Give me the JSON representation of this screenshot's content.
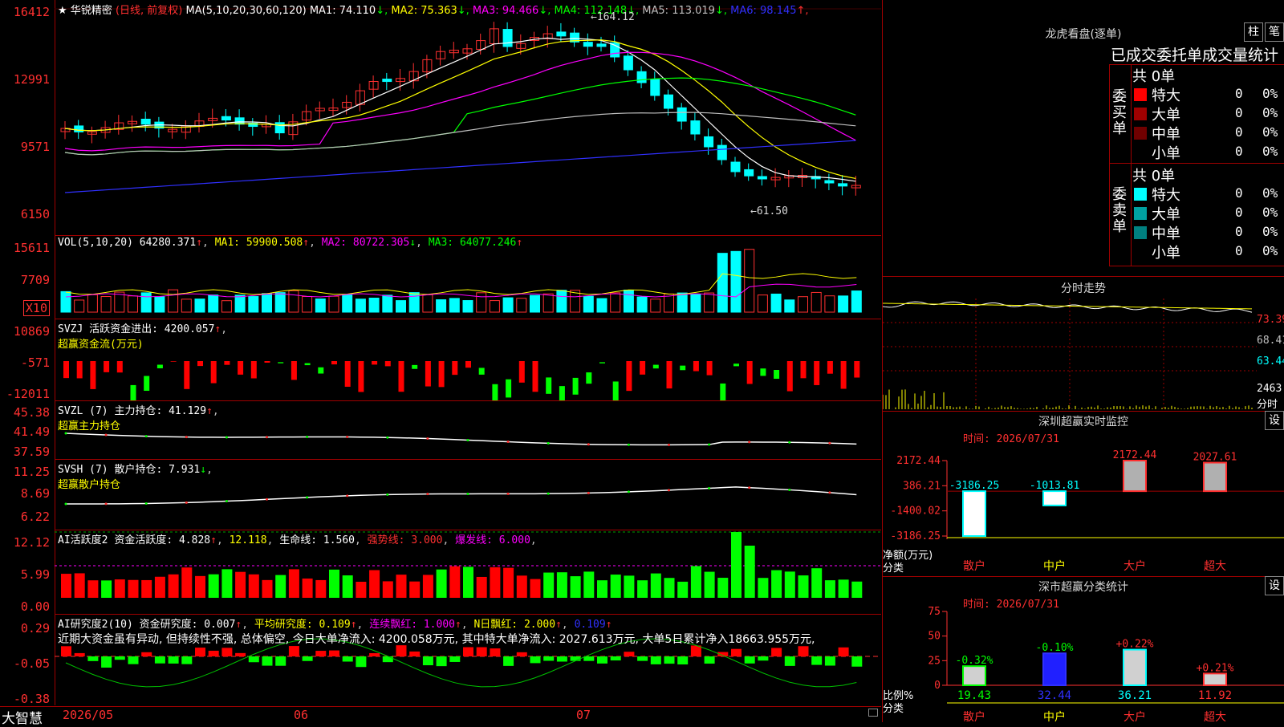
{
  "stock": {
    "name": "华锐精密",
    "mode": "(日线, 前复权)"
  },
  "price_pane": {
    "ma_header": "MA(5,10,20,30,60,120)",
    "ma": [
      {
        "label": "MA1: 74.110",
        "arrow": "↓",
        "color": "#ffffff"
      },
      {
        "label": "MA2: 75.363",
        "arrow": "↓",
        "color": "#ffff00"
      },
      {
        "label": "MA3: 94.466",
        "arrow": "↓",
        "color": "#ff00ff"
      },
      {
        "label": "MA4: 112.148",
        "arrow": "↓",
        "color": "#00ff00"
      },
      {
        "label": "MA5: 113.019",
        "arrow": "↓",
        "color": "#c0c0c0"
      },
      {
        "label": "MA6: 98.145",
        "arrow": "↑",
        "color": "#3030ff"
      }
    ],
    "y_labels": [
      "16412",
      "12991",
      "9571",
      "6150"
    ],
    "high_note": "164.12",
    "low_note": "61.50"
  },
  "vol_pane": {
    "name": "VOL(5,10,20)",
    "value": "64280.371",
    "ma1": "MA1: 59900.508",
    "ma2": "MA2: 80722.305",
    "ma3": "MA3: 64077.246",
    "y_labels": [
      "15611",
      "7709"
    ],
    "unit": "X10"
  },
  "svzj_pane": {
    "name": "SVZJ",
    "title": "活跃资金进出: 4200.057",
    "sub": "超赢资金流(万元)",
    "y_labels": [
      "10869",
      "-571",
      "-12011"
    ]
  },
  "svzl_pane": {
    "name": "SVZL (7)",
    "title": "主力持仓: 41.129",
    "sub": "超赢主力持仓",
    "y_labels": [
      "45.38",
      "41.49",
      "37.59"
    ]
  },
  "svsh_pane": {
    "name": "SVSH (7)",
    "title": "散户持仓: 7.931",
    "sub": "超赢散户持仓",
    "y_labels": [
      "11.25",
      "8.69",
      "6.22"
    ]
  },
  "ai_active": {
    "name": "AI活跃度2",
    "a": "资金活跃度: 4.828",
    "b": "12.118",
    "c": "生命线: 1.560",
    "d": "强势线: 3.000",
    "e": "爆发线: 6.000",
    "y_labels": [
      "12.12",
      "5.99",
      "0.00"
    ]
  },
  "ai_research": {
    "name": "AI研究度2(10)",
    "a": "资金研究度: 0.007",
    "b": "平均研究度: 0.109",
    "c": "连续飘红: 1.000",
    "d": "N日飘红: 2.000",
    "e": "0.109",
    "comment": "近期大资金虽有异动, 但持续性不强, 总体偏空, 今日大单净流入: 4200.058万元, 其中特大单净流入: 2027.613万元, 大单5日累计净入18663.955万元,",
    "y_labels": [
      "0.29",
      "-0.05",
      "-0.38"
    ]
  },
  "bottom": {
    "brand": "大智慧",
    "months": [
      "2026/05",
      "06",
      "07"
    ]
  },
  "dragon": {
    "title": "龙虎看盘(逐单)",
    "btn1": "柱",
    "btn2": "笔",
    "subtitle": "已成交委托单成交量统计",
    "buy_label": "委买单",
    "sell_label": "委卖单",
    "buy_total": "共 0单",
    "sell_total": "共 0单",
    "buy_rows": [
      {
        "name": "特大",
        "qty": "0",
        "pct": "0%",
        "color": "#ff0000"
      },
      {
        "name": "大单",
        "qty": "0",
        "pct": "0%",
        "color": "#a00000"
      },
      {
        "name": "中单",
        "qty": "0",
        "pct": "0%",
        "color": "#700000"
      },
      {
        "name": "小单",
        "qty": "0",
        "pct": "0%",
        "color": "#000000"
      }
    ],
    "sell_rows": [
      {
        "name": "特大",
        "qty": "0",
        "pct": "0%",
        "color": "#00ffff"
      },
      {
        "name": "大单",
        "qty": "0",
        "pct": "0%",
        "color": "#00a0a0"
      },
      {
        "name": "中单",
        "qty": "0",
        "pct": "0%",
        "color": "#008080"
      },
      {
        "name": "小单",
        "qty": "0",
        "pct": "0%",
        "color": "#000000"
      }
    ]
  },
  "intraday": {
    "title": "分时走势",
    "y1": "73.39",
    "y2": "68.41",
    "y3": "63.44",
    "vol": "2463",
    "unit": "分时"
  },
  "sz_monitor": {
    "title": "深圳超赢实时监控",
    "btn": "设",
    "time": "时间: 2026/07/31",
    "y_labels": [
      "2172.44",
      "386.21",
      "-1400.02",
      "-3186.25"
    ],
    "left_label1": "净额(万元)",
    "left_label2": "分类",
    "categories": [
      "散户",
      "中户",
      "大户",
      "超大"
    ],
    "values": [
      -3186.25,
      -1013.81,
      2172.44,
      2027.61
    ],
    "value_labels": [
      "-3186.25",
      "-1013.81",
      "2172.44",
      "2027.61"
    ]
  },
  "sz_class": {
    "title": "深市超赢分类统计",
    "btn": "设",
    "time": "时间: 2026/07/31",
    "y_labels": [
      "75",
      "50",
      "25",
      "0"
    ],
    "left_label1": "比例%",
    "left_label2": "分类",
    "categories": [
      "散户",
      "中户",
      "大户",
      "超大"
    ],
    "values": [
      19.43,
      32.44,
      36.21,
      11.92
    ],
    "changes": [
      "-0.32%",
      "-0.10%",
      "+0.22%",
      "+0.21%"
    ]
  }
}
